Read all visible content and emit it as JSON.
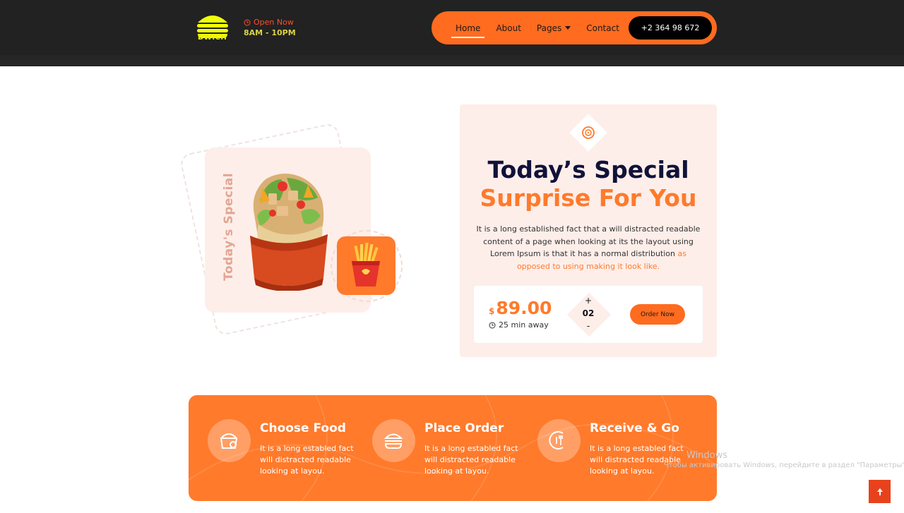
{
  "header": {
    "logo_text": "DWICH",
    "open_status": "Open Now",
    "hours": "8AM - 10PM",
    "nav": [
      {
        "label": "Home",
        "active": true
      },
      {
        "label": "About"
      },
      {
        "label": "Pages",
        "dropdown": true
      },
      {
        "label": "Contact"
      }
    ],
    "phone": "+2 364 98 672"
  },
  "special": {
    "side_label": "Today's Special",
    "title_line1": "Today’s Special",
    "title_line2": "Surprise For You",
    "description": "It is a long established fact that a will distracted readable content of a page when looking at its the layout using Lorem Ipsum is that it has a normal distribution ",
    "description_highlight": "as opposed to using making it look like.",
    "currency": "$",
    "price": "89.00",
    "eta": "25 min away",
    "quantity": "02",
    "plus": "+",
    "minus": "-",
    "order_label": "Order Now"
  },
  "steps": [
    {
      "title": "Choose Food",
      "text": "It is a long establed fact will distracted readable looking at layou.",
      "icon": "food-box-icon"
    },
    {
      "title": "Place Order",
      "text": "It is a long establed fact will distracted readable looking at layou.",
      "icon": "burger-icon"
    },
    {
      "title": "Receive & Go",
      "text": "It is a long establed fact will distracted readable looking at layou.",
      "icon": "delivery-icon"
    }
  ],
  "watermark": {
    "line1": "Windows",
    "line2": "Чтобы активировать Windows, перейдите в раздел \"Параметры\"."
  },
  "colors": {
    "accent": "#ff7a2b",
    "header_bg": "#222222",
    "title_dark": "#10123a",
    "card_bg": "#fdeee9"
  }
}
